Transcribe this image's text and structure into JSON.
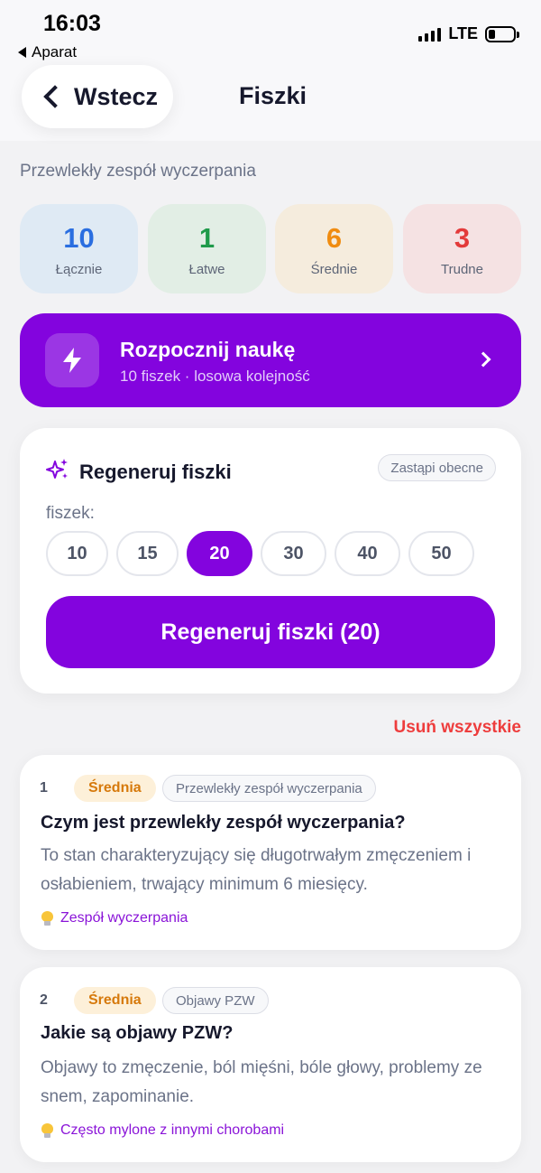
{
  "status_bar": {
    "time": "16:03",
    "back_app": "Aparat",
    "network": "LTE"
  },
  "nav": {
    "back_label": "Wstecz",
    "title": "Fiszki"
  },
  "deck": {
    "title": "Przewlekły zespół wyczerpania"
  },
  "stats": [
    {
      "value": "10",
      "label": "Łącznie",
      "color": "#2a6ee0",
      "bg": "#dfeaf4"
    },
    {
      "value": "1",
      "label": "Łatwe",
      "color": "#1f9a4a",
      "bg": "#e2eee5"
    },
    {
      "value": "6",
      "label": "Średnie",
      "color": "#f08c10",
      "bg": "#f5ecdd"
    },
    {
      "value": "3",
      "label": "Trudne",
      "color": "#e33a3a",
      "bg": "#f5e2e3"
    }
  ],
  "start": {
    "title": "Rozpocznij naukę",
    "subtitle": "10 fiszek · losowa kolejność",
    "icon": "lightning-icon"
  },
  "regenerate": {
    "title": "Regeneruj fiszki",
    "replace_badge": "Zastąpi obecne",
    "count_label": "fiszek:",
    "options": [
      "10",
      "15",
      "20",
      "30",
      "40",
      "50"
    ],
    "selected": "20",
    "button_label": "Regeneruj fiszki (20)",
    "icon": "sparkles-icon"
  },
  "delete_all_label": "Usuń wszystkie",
  "cards": [
    {
      "index": "1",
      "difficulty": "Średnia",
      "topic": "Przewlekły zespół wyczerpania",
      "question": "Czym jest przewlekły zespół wyczerpania?",
      "answer": "To stan charakteryzujący się długotrwałym zmęczeniem i osłabieniem, trwający minimum 6 miesięcy.",
      "hint": "Zespół wyczerpania"
    },
    {
      "index": "2",
      "difficulty": "Średnia",
      "topic": "Objawy PZW",
      "question": "Jakie są objawy PZW?",
      "answer": "Objawy to zmęczenie, ból mięśni, bóle głowy, problemy ze snem, zapominanie.",
      "hint": "Często mylone z innymi chorobami"
    }
  ],
  "colors": {
    "accent": "#8304de",
    "danger": "#ee3d3d",
    "medium": "#d6790b"
  }
}
